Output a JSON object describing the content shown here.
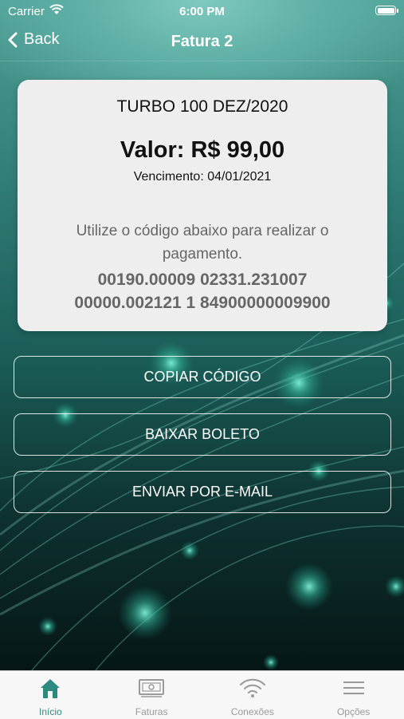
{
  "status_bar": {
    "carrier": "Carrier",
    "time": "6:00 PM"
  },
  "nav": {
    "back_label": "Back",
    "title": "Fatura 2"
  },
  "invoice": {
    "plan_name": "TURBO 100 DEZ/2020",
    "amount": "Valor: R$ 99,00",
    "due_date": "Vencimento: 04/01/2021",
    "instruction": "Utilize o código abaixo para realizar o pagamento.",
    "barcode_line1": "00190.00009 02331.231007",
    "barcode_line2": "00000.002121 1 84900000009900"
  },
  "actions": {
    "copy_label": "COPIAR CÓDIGO",
    "download_label": "BAIXAR BOLETO",
    "email_label": "ENVIAR POR E-MAIL"
  },
  "tabs": [
    {
      "label": "Início",
      "icon": "home-icon",
      "active": true
    },
    {
      "label": "Faturas",
      "icon": "bill-icon"
    },
    {
      "label": "Conexões",
      "icon": "wifi-icon"
    },
    {
      "label": "Opções",
      "icon": "menu-icon"
    }
  ],
  "colors": {
    "accent": "#2c8a7e",
    "tab_inactive": "#9a9a9a",
    "card_bg": "#eeeeee"
  }
}
